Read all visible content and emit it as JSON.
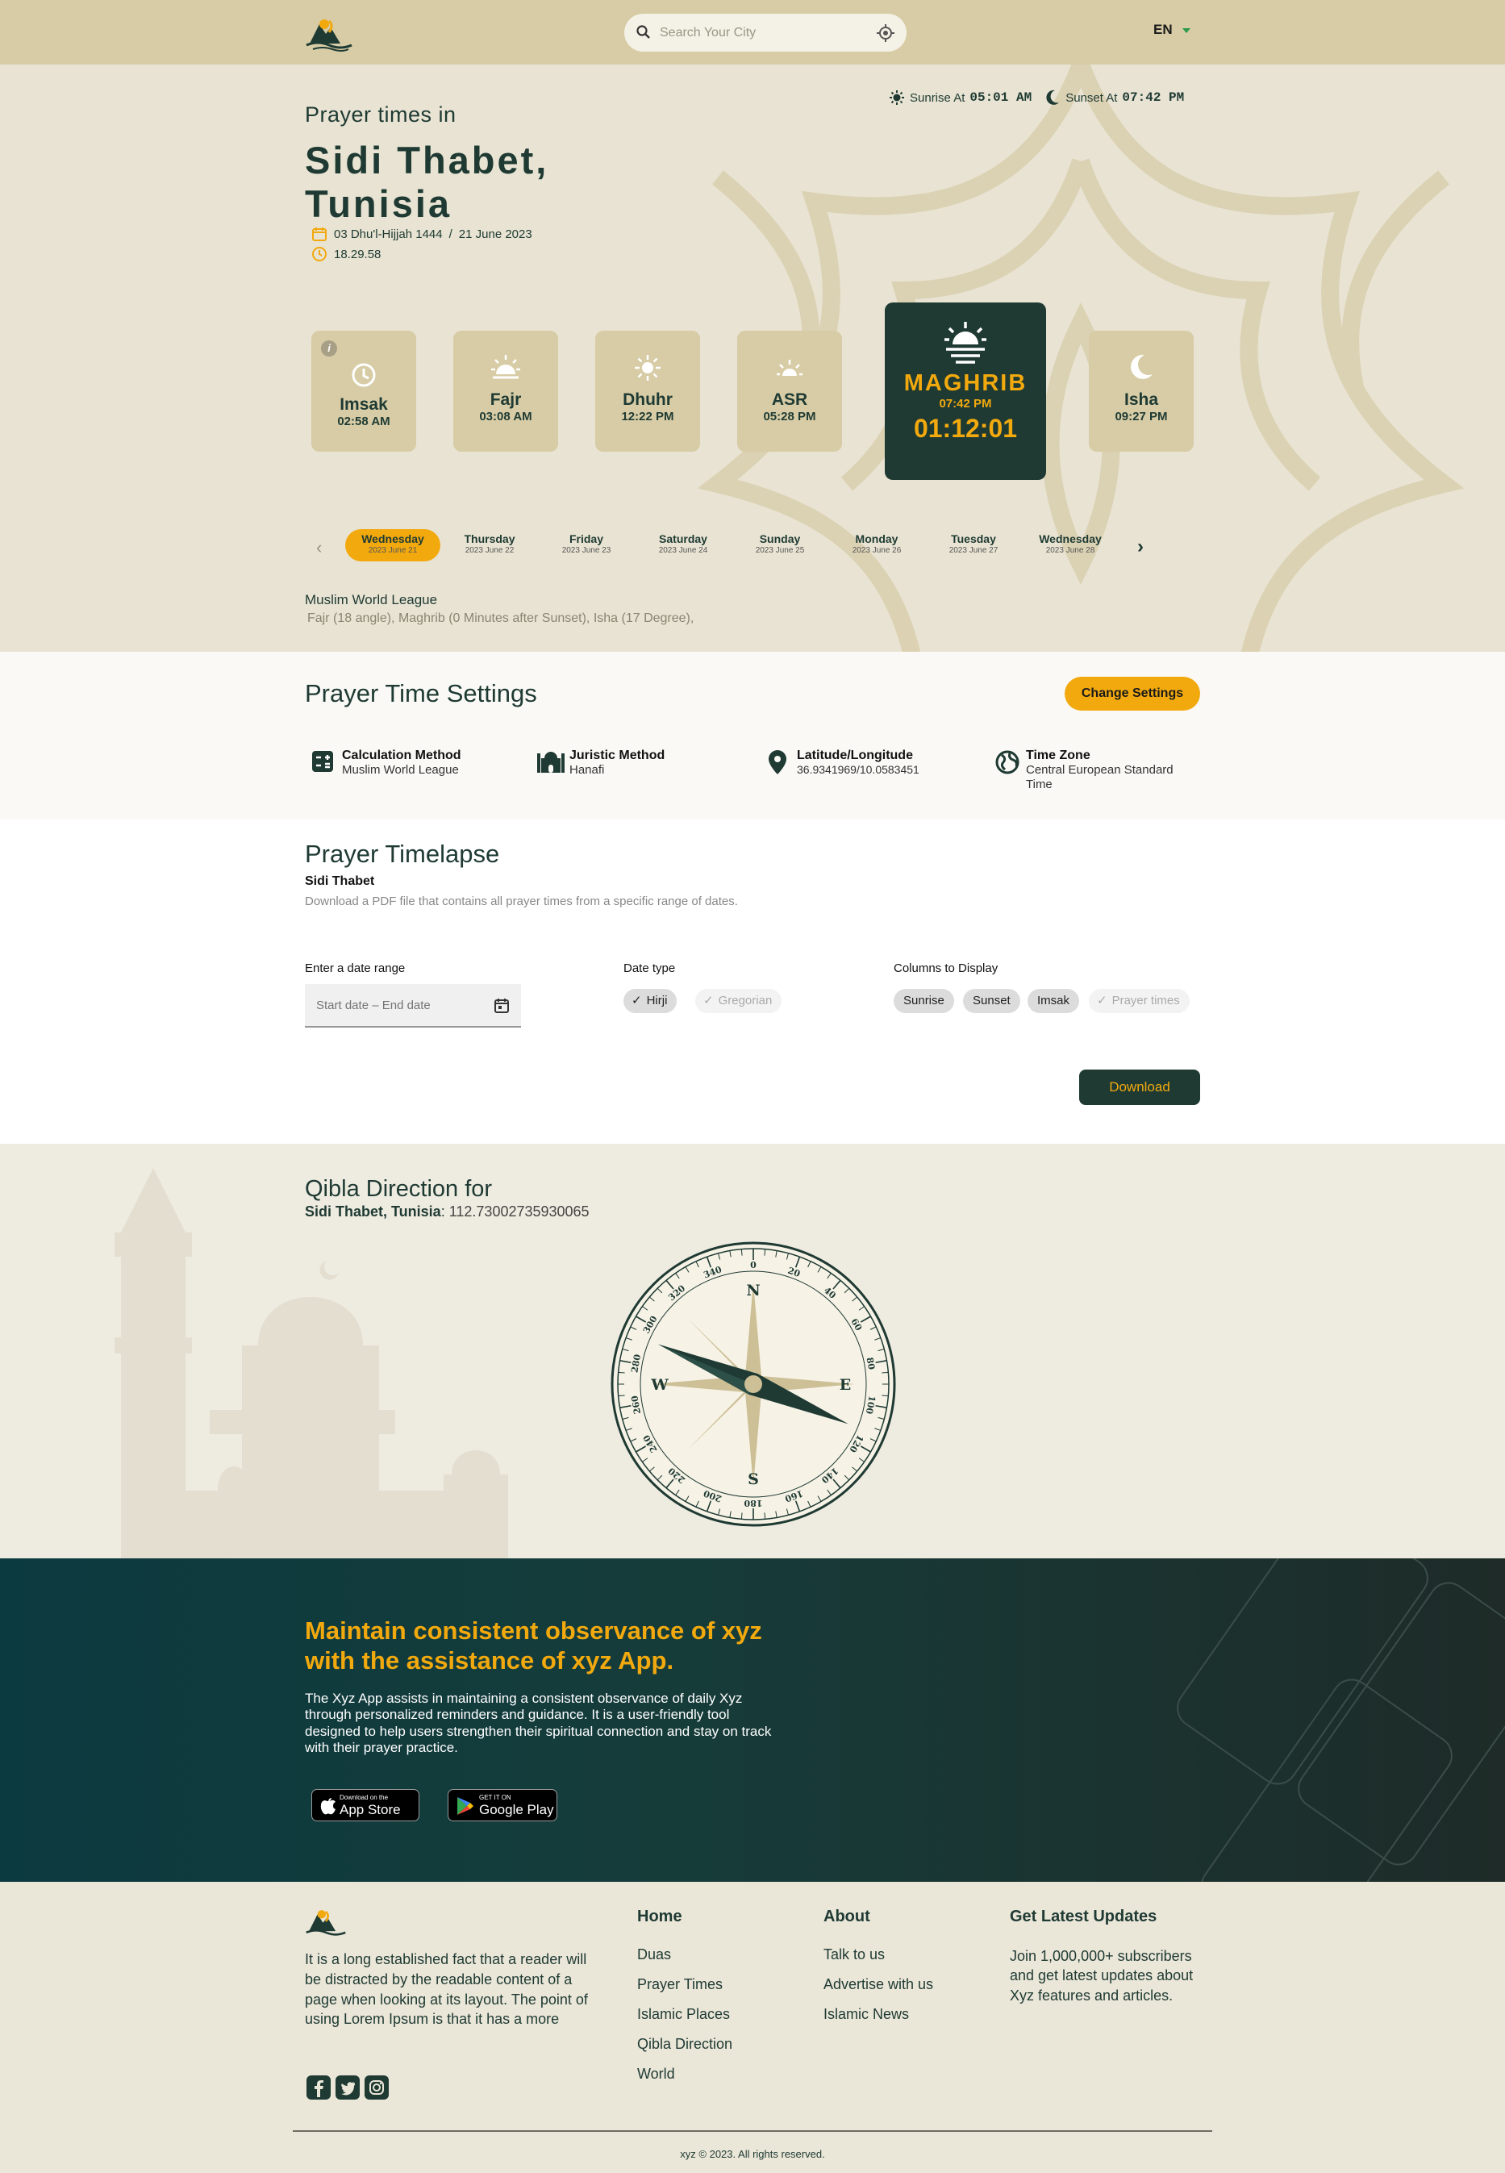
{
  "header": {
    "search_placeholder": "Search Your City",
    "language": "EN"
  },
  "hero": {
    "title_small": "Prayer times in",
    "city": "Sidi Thabet, Tunisia",
    "hijri_date": "03 Dhu'l-Hijjah 1444",
    "date_separator": "/",
    "gregorian_date": "21 June 2023",
    "current_time": "18.29.58",
    "sunrise_label": "Sunrise At",
    "sunrise_time": "05:01 AM",
    "sunset_label": "Sunset At",
    "sunset_time": "07:42 PM"
  },
  "prayers": [
    {
      "name": "Imsak",
      "time": "02:58 AM",
      "icon": "clock-icon"
    },
    {
      "name": "Fajr",
      "time": "03:08 AM",
      "icon": "sunrise-icon"
    },
    {
      "name": "Dhuhr",
      "time": "12:22 PM",
      "icon": "sun-icon"
    },
    {
      "name": "ASR",
      "time": "05:28 PM",
      "icon": "sun-low-icon"
    },
    {
      "name": "MAGHRIB",
      "time": "07:42 PM",
      "countdown": "01:12:01",
      "icon": "sunset-icon"
    },
    {
      "name": "Isha",
      "time": "09:27 PM",
      "icon": "moon-icon"
    }
  ],
  "days": [
    {
      "name": "Wednesday",
      "date": "2023 June 21",
      "selected": true
    },
    {
      "name": "Thursday",
      "date": "2023 June 22"
    },
    {
      "name": "Friday",
      "date": "2023 June 23"
    },
    {
      "name": "Saturday",
      "date": "2023 June 24"
    },
    {
      "name": "Sunday",
      "date": "2023 June 25"
    },
    {
      "name": "Monday",
      "date": "2023 June 26"
    },
    {
      "name": "Tuesday",
      "date": "2023 June 27"
    },
    {
      "name": "Wednesday",
      "date": "2023 June 28"
    }
  ],
  "method": {
    "name": "Muslim World League",
    "details": "Fajr (18 angle), Maghrib (0 Minutes after Sunset), Isha (17 Degree),"
  },
  "settings": {
    "title": "Prayer Time Settings",
    "change_button": "Change Settings",
    "items": [
      {
        "label": "Calculation Method",
        "value": "Muslim World League",
        "icon": "calculator-icon"
      },
      {
        "label": "Juristic Method",
        "value": "Hanafi",
        "icon": "mosque-icon"
      },
      {
        "label": "Latitude/Longitude",
        "value": "36.9341969/10.0583451",
        "icon": "location-pin-icon"
      },
      {
        "label": "Time Zone",
        "value": "Central European Standard Time",
        "icon": "globe-icon"
      }
    ]
  },
  "timelapse": {
    "title": "Prayer Timelapse",
    "city": "Sidi Thabet",
    "description": "Download a PDF file that contains all prayer times from a specific range of dates.",
    "date_range_label": "Enter a date range",
    "date_range_placeholder": "Start date – End date",
    "date_type_label": "Date type",
    "date_types": [
      {
        "label": "Hirji",
        "selected": true
      },
      {
        "label": "Gregorian",
        "selected": false
      }
    ],
    "columns_label": "Columns to Display",
    "columns": [
      {
        "label": "Sunrise",
        "selected": true
      },
      {
        "label": "Sunset",
        "selected": true
      },
      {
        "label": "Imsak",
        "selected": true
      },
      {
        "label": "Prayer times",
        "selected": false
      }
    ],
    "download_button": "Download"
  },
  "qibla": {
    "title": "Qibla Direction for",
    "city": "Sidi Thabet, Tunisia",
    "separator": ":",
    "degrees": "112.73002735930065",
    "compass_labels": {
      "n": "N",
      "e": "E",
      "s": "S",
      "w": "W"
    },
    "compass_ticks": [
      "0",
      "20",
      "40",
      "60",
      "80",
      "100",
      "120",
      "140",
      "160",
      "180",
      "200",
      "220",
      "240",
      "260",
      "280",
      "300",
      "320",
      "340"
    ]
  },
  "banner": {
    "title": "Maintain consistent observance of xyz with the assistance of xyz App.",
    "body": "The Xyz App assists in maintaining a consistent observance of daily Xyz through personalized reminders and guidance. It is a user-friendly tool designed to help users strengthen their spiritual connection and stay on track with their prayer practice.",
    "appstore_small": "Download on the",
    "appstore_big": "App Store",
    "googleplay_small": "GET IT ON",
    "googleplay_big": "Google Play"
  },
  "footer": {
    "about_text": "It is a long established fact that a reader will be distracted by the readable content of a page when looking at its layout. The point of using Lorem Ipsum is that it has a more",
    "home_heading": "Home",
    "home_links": [
      "Duas",
      "Prayer Times",
      "Islamic Places",
      "Qibla Direction",
      "World"
    ],
    "about_heading": "About",
    "about_links": [
      "Talk to us",
      "Advertise with us",
      "Islamic News"
    ],
    "updates_heading": "Get Latest Updates",
    "updates_text": "Join 1,000,000+ subscribers and get latest updates about Xyz features and articles.",
    "copyright": "xyz © 2023. All rights reserved."
  },
  "colors": {
    "primary_dark": "#1E3A33",
    "accent": "#F2A90E",
    "header_bg": "#D7CCA5",
    "card_bg": "#D7CCA5"
  }
}
